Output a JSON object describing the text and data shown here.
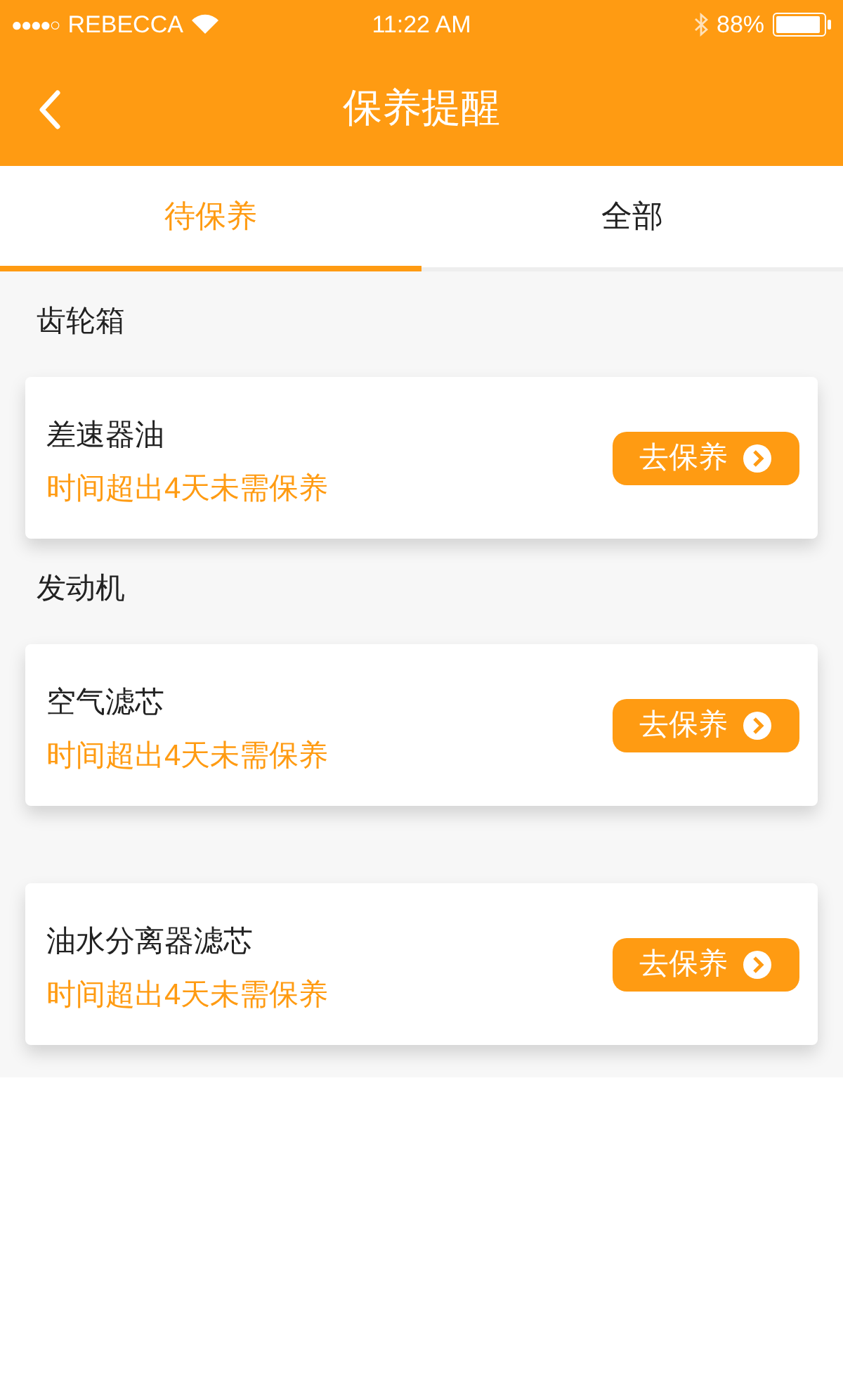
{
  "status_bar": {
    "signal": "●●●●○",
    "carrier": "REBECCA",
    "time": "11:22 AM",
    "battery": "88%"
  },
  "nav": {
    "title": "保养提醒"
  },
  "tabs": [
    {
      "label": "待保养",
      "selected": true
    },
    {
      "label": "全部",
      "selected": false
    }
  ],
  "groups": [
    {
      "title": "齿轮箱",
      "items": [
        {
          "name": "差速器油",
          "status": "时间超出4天未需保养",
          "action": "去保养"
        }
      ]
    },
    {
      "title": "发动机",
      "items": [
        {
          "name": "空气滤芯",
          "status": "时间超出4天未需保养",
          "action": "去保养"
        }
      ]
    },
    {
      "items": [
        {
          "name": "油水分离器滤芯",
          "status": "时间超出4天未需保养",
          "action": "去保养"
        }
      ]
    }
  ]
}
